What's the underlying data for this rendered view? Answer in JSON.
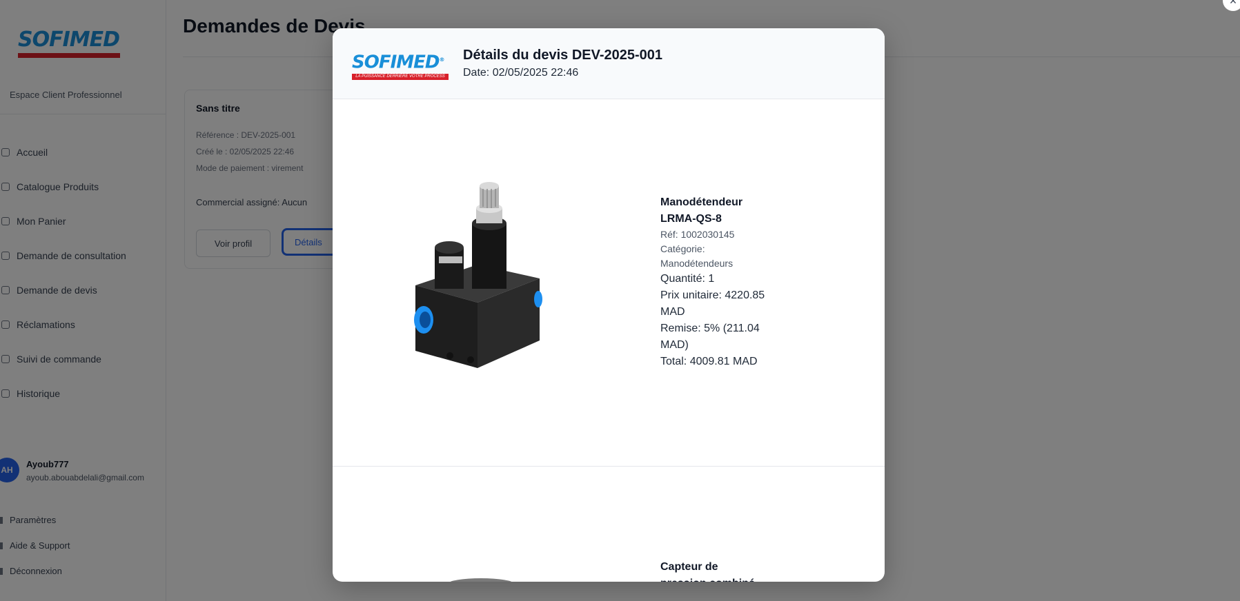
{
  "sidebar": {
    "logo_text": "SOFIMED",
    "subtitle": "Espace Client Professionnel",
    "nav_items": [
      {
        "label": "Accueil"
      },
      {
        "label": "Catalogue Produits"
      },
      {
        "label": "Mon Panier"
      },
      {
        "label": "Demande de consultation"
      },
      {
        "label": "Demande de devis"
      },
      {
        "label": "Réclamations"
      },
      {
        "label": "Suivi de commande"
      },
      {
        "label": "Historique"
      }
    ],
    "user": {
      "initials": "AH",
      "name": "Ayoub777",
      "email": "ayoub.abouabdelali@gmail.com"
    },
    "bottom_links": [
      {
        "label": "Paramètres"
      },
      {
        "label": "Aide & Support"
      },
      {
        "label": "Déconnexion"
      }
    ]
  },
  "main": {
    "title": "Demandes de Devis",
    "card": {
      "title": "Sans titre",
      "reference": "Référence : DEV-2025-001",
      "created": "Créé le : 02/05/2025 22:46",
      "payment": "Mode de paiement : virement",
      "commercial": "Commercial assigné: Aucun",
      "view_profile_label": "Voir profil",
      "details_label": "Détails"
    }
  },
  "modal": {
    "logo_text": "SOFIMED",
    "logo_reg": "®",
    "logo_tagline": "LA PUISSANCE DERRIÈRE VOTRE PROCESS",
    "title": "Détails du devis DEV-2025-001",
    "date": "Date: 02/05/2025 22:46",
    "items": [
      {
        "name_line1": "Manodétendeur",
        "name_line2": "LRMA-QS-8",
        "ref": "Réf: 1002030145",
        "category_label": "Catégorie:",
        "category": "Manodétendeurs",
        "quantity": "Quantité: 1",
        "unit_price_line1": "Prix unitaire: 4220.85",
        "unit_price_line2": "MAD",
        "discount_line1": "Remise: 5% (211.04",
        "discount_line2": "MAD)",
        "total": "Total: 4009.81 MAD"
      },
      {
        "name_line1": "Capteur de",
        "name_line2": "pression combiné"
      }
    ]
  },
  "icons": {
    "close": "×"
  },
  "colors": {
    "brand_blue": "#1a8fd8",
    "brand_red": "#d8202a",
    "primary": "#2563eb"
  }
}
